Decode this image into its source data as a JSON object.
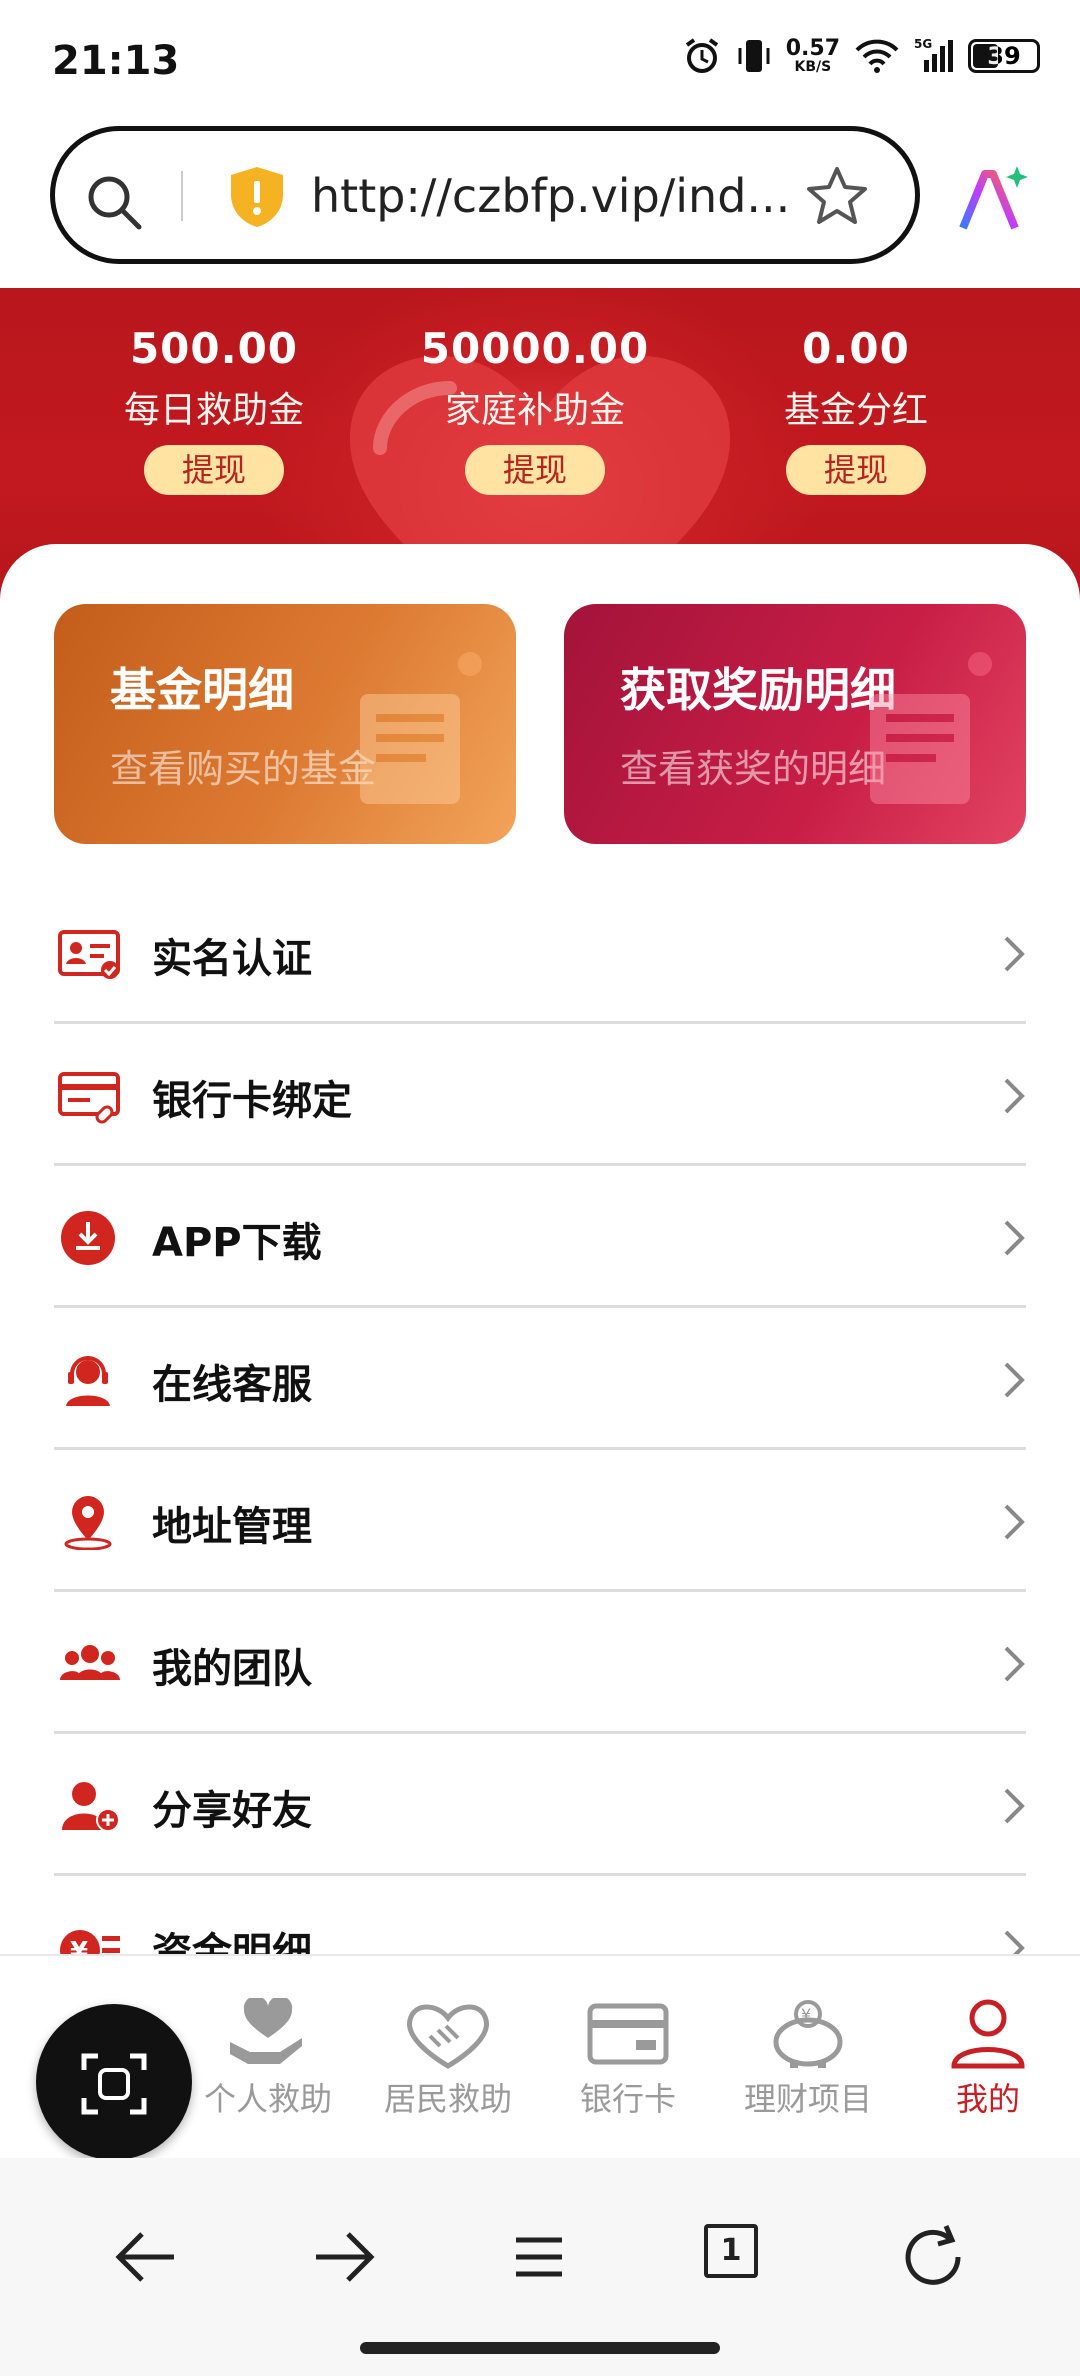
{
  "status_bar": {
    "time": "21:13",
    "net_speed": "0.57",
    "net_unit": "KB/S",
    "network": "5G",
    "battery": "39",
    "icons": [
      "alarm-icon",
      "vibrate-icon",
      "wifi-icon",
      "signal-icon",
      "battery-icon"
    ]
  },
  "browser": {
    "url": "http://czbfp.vip/ind...",
    "tab_count": "1",
    "icons": [
      "search-icon",
      "shield-warning-icon",
      "star-icon",
      "ai-assistant-icon",
      "back-icon",
      "forward-icon",
      "menu-icon",
      "tabs-icon",
      "refresh-icon"
    ]
  },
  "hero": {
    "stats": [
      {
        "value": "500.00",
        "label": "每日救助金",
        "button": "提现"
      },
      {
        "value": "50000.00",
        "label": "家庭补助金",
        "button": "提现"
      },
      {
        "value": "0.00",
        "label": "基金分红",
        "button": "提现"
      }
    ]
  },
  "cards": [
    {
      "title": "基金明细",
      "subtitle": "查看购买的基金"
    },
    {
      "title": "获取奖励明细",
      "subtitle": "查看获奖的明细"
    }
  ],
  "menu": [
    {
      "label": "实名认证",
      "icon": "id-card-icon"
    },
    {
      "label": "银行卡绑定",
      "icon": "bank-card-link-icon"
    },
    {
      "label": "APP下载",
      "icon": "download-icon"
    },
    {
      "label": "在线客服",
      "icon": "customer-service-icon"
    },
    {
      "label": "地址管理",
      "icon": "location-pin-icon"
    },
    {
      "label": "我的团队",
      "icon": "team-icon"
    },
    {
      "label": "分享好友",
      "icon": "add-friend-icon"
    },
    {
      "label": "资金明细",
      "icon": "fund-detail-icon"
    }
  ],
  "bottom_nav": [
    {
      "label": "个人救助",
      "icon": "heart-hand-icon"
    },
    {
      "label": "居民救助",
      "icon": "handshake-icon"
    },
    {
      "label": "银行卡",
      "icon": "bank-card-icon"
    },
    {
      "label": "理财项目",
      "icon": "piggy-bank-icon"
    },
    {
      "label": "我的",
      "icon": "user-icon",
      "active": true
    }
  ],
  "colors": {
    "brand_red": "#c81f24",
    "withdraw_bg": "#ffe3a3",
    "inactive_nav": "#9a9a9a"
  }
}
